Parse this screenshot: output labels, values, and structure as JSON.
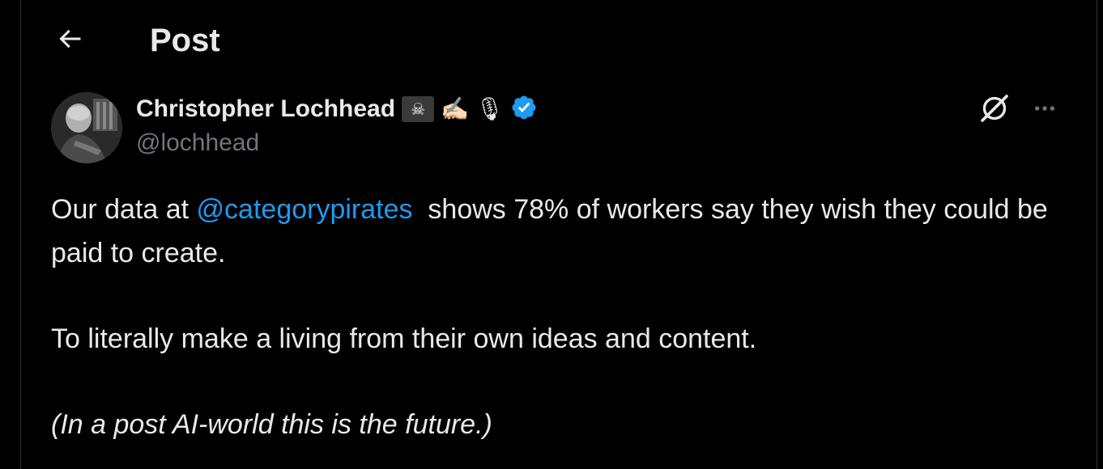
{
  "header": {
    "title": "Post",
    "back_icon": "arrow-left-icon"
  },
  "author": {
    "display_name": "Christopher Lochhead",
    "handle": "@lochhead",
    "badges": [
      "pirate-flag-emoji",
      "writing-hand-emoji",
      "microphone-emoji"
    ],
    "emoji_writing": "✍🏻",
    "emoji_mic": "🎙",
    "emoji_flag": "☠",
    "verified": true,
    "verified_color": "#1d9bf0"
  },
  "actions": {
    "grok_icon": "grok-icon",
    "more_icon": "more-horizontal-icon"
  },
  "tweet": {
    "line1_before": "Our data at ",
    "mention": "@categorypirates",
    "line1_after": "  shows 78% of workers say they wish they could be paid to create.",
    "paragraph2": "To literally make a living from their own ideas and content.",
    "paragraph3": "(In a post AI-world this is the future.)"
  },
  "colors": {
    "background": "#000000",
    "text": "#e7e9ea",
    "secondary": "#71767b",
    "accent": "#1d9bf0"
  }
}
